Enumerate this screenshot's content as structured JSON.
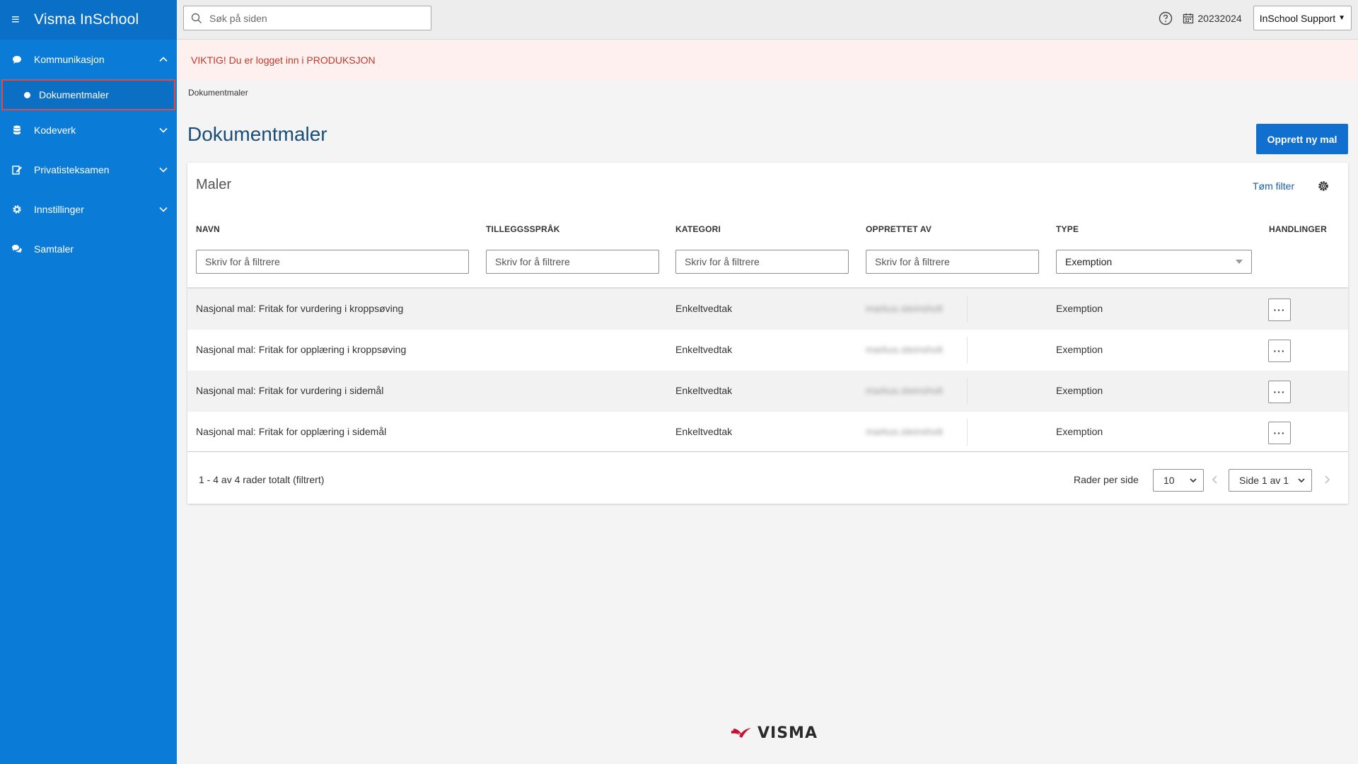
{
  "app": {
    "title": "Visma InSchool",
    "brand_color": "#0b7bd8"
  },
  "topbar": {
    "search_placeholder": "Søk på siden",
    "school_year": "20232024",
    "user_menu": "InSchool Support"
  },
  "sidebar": {
    "items": [
      {
        "label": "Kommunikasjon",
        "icon": "chat-bubble-icon",
        "expanded": true
      },
      {
        "label": "Dokumentmaler",
        "icon": "dot-icon",
        "active": true
      },
      {
        "label": "Kodeverk",
        "icon": "database-icon"
      },
      {
        "label": "Privatisteksamen",
        "icon": "edit-document-icon"
      },
      {
        "label": "Innstillinger",
        "icon": "gear-icon"
      },
      {
        "label": "Samtaler",
        "icon": "conversation-icon"
      }
    ]
  },
  "banner": {
    "text": "VIKTIG! Du er logget inn i PRODUKSJON"
  },
  "breadcrumb": "Dokumentmaler",
  "page": {
    "title": "Dokumentmaler",
    "create_button": "Opprett ny mal"
  },
  "card": {
    "title": "Maler",
    "clear_filter": "Tøm filter"
  },
  "table": {
    "columns": {
      "name": "NAVN",
      "language": "TILLEGGSSPRÅK",
      "category": "KATEGORI",
      "created_by": "OPPRETTET AV",
      "type": "TYPE",
      "actions": "HANDLINGER"
    },
    "filter_placeholder": "Skriv for å filtrere",
    "type_filter_value": "Exemption",
    "rows": [
      {
        "name": "Nasjonal mal: Fritak for vurdering i kroppsøving",
        "language": "",
        "category": "Enkeltvedtak",
        "created_by": "markus.steinsholt",
        "type": "Exemption",
        "actions": "···"
      },
      {
        "name": "Nasjonal mal: Fritak for opplæring i kroppsøving",
        "language": "",
        "category": "Enkeltvedtak",
        "created_by": "markus.steinsholt",
        "type": "Exemption",
        "actions": "···"
      },
      {
        "name": "Nasjonal mal: Fritak for vurdering i sidemål",
        "language": "",
        "category": "Enkeltvedtak",
        "created_by": "markus.steinsholt",
        "type": "Exemption",
        "actions": "···"
      },
      {
        "name": "Nasjonal mal: Fritak for opplæring i sidemål",
        "language": "",
        "category": "Enkeltvedtak",
        "created_by": "markus.steinsholt",
        "type": "Exemption",
        "actions": "···"
      }
    ]
  },
  "pagination": {
    "count_text": "1 - 4 av 4 rader totalt (filtrert)",
    "rows_per_page_label": "Rader per side",
    "rows_per_page_value": "10",
    "page_value": "Side 1 av 1"
  },
  "footer": {
    "logo_text": "VISMA"
  }
}
